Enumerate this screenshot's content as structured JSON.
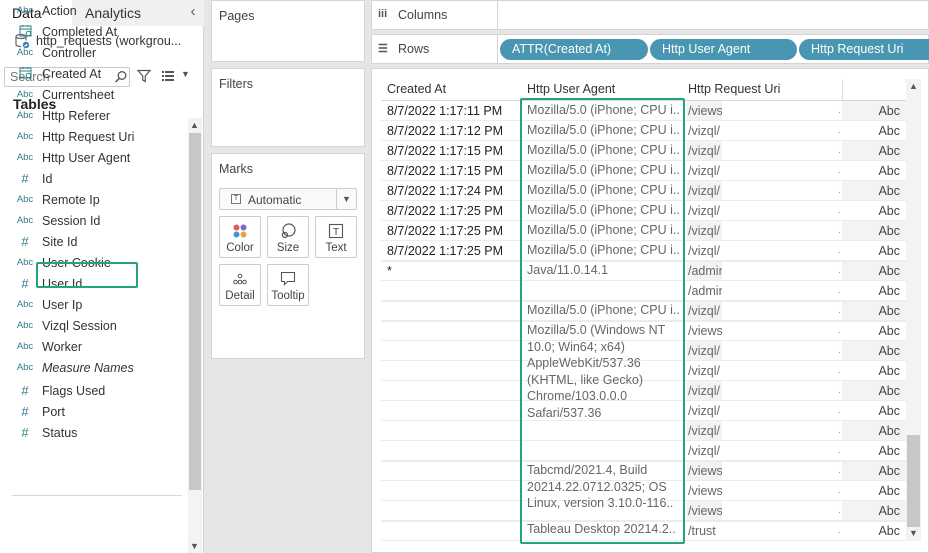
{
  "left_pane": {
    "tab_data": "Data",
    "tab_analytics": "Analytics",
    "datasource": "http_requests (workgrou...",
    "search_placeholder": "Search",
    "tables_title": "Tables",
    "fields": [
      {
        "type": "Abc",
        "name": "Action"
      },
      {
        "type": "date",
        "name": "Completed At"
      },
      {
        "type": "Abc",
        "name": "Controller"
      },
      {
        "type": "date",
        "name": "Created At"
      },
      {
        "type": "Abc",
        "name": "Currentsheet"
      },
      {
        "type": "Abc",
        "name": "Http Referer"
      },
      {
        "type": "Abc",
        "name": "Http Request Uri"
      },
      {
        "type": "Abc",
        "name": "Http User Agent"
      },
      {
        "type": "#",
        "name": "Id"
      },
      {
        "type": "Abc",
        "name": "Remote Ip"
      },
      {
        "type": "Abc",
        "name": "Session Id"
      },
      {
        "type": "#",
        "name": "Site Id"
      },
      {
        "type": "Abc",
        "name": "User Cookie"
      },
      {
        "type": "#",
        "name": "User Id"
      },
      {
        "type": "Abc",
        "name": "User Ip"
      },
      {
        "type": "Abc",
        "name": "Vizql Session"
      },
      {
        "type": "Abc",
        "name": "Worker"
      },
      {
        "type": "Abc",
        "name": "Measure Names"
      }
    ],
    "measures": [
      {
        "type": "#",
        "name": "Flags Used"
      },
      {
        "type": "#",
        "name": "Port"
      },
      {
        "type": "#",
        "name": "Status"
      }
    ],
    "selected_field": "Http User Agent"
  },
  "shelves": {
    "pages": "Pages",
    "filters": "Filters",
    "marks": "Marks",
    "mark_type": "Automatic",
    "mark_buttons": [
      "Color",
      "Size",
      "Text",
      "Detail",
      "Tooltip"
    ],
    "columns": "Columns",
    "rows": "Rows",
    "row_pills": [
      "ATTR(Created At)",
      "Http User Agent",
      "Http Request Uri"
    ]
  },
  "table": {
    "headers": [
      "Created At",
      "Http User Agent",
      "Http Request Uri"
    ],
    "dates": [
      "8/7/2022 1:17:11 PM",
      "8/7/2022 1:17:12 PM",
      "8/7/2022 1:17:15 PM",
      "8/7/2022 1:17:15 PM",
      "8/7/2022 1:17:24 PM",
      "8/7/2022 1:17:25 PM",
      "8/7/2022 1:17:25 PM",
      "8/7/2022 1:17:25 PM",
      "*"
    ],
    "agents": [
      "Mozilla/5.0 (iPhone; CPU i..",
      "Mozilla/5.0 (iPhone; CPU i..",
      "Mozilla/5.0 (iPhone; CPU i..",
      "Mozilla/5.0 (iPhone; CPU i..",
      "Mozilla/5.0 (iPhone; CPU i..",
      "Mozilla/5.0 (iPhone; CPU i..",
      "Mozilla/5.0 (iPhone; CPU i..",
      "Mozilla/5.0 (iPhone; CPU i..",
      "Java/11.0.14.1",
      "Mozilla/5.0 (iPhone; CPU i..",
      "Mozilla/5.0 (Windows NT 10.0; Win64; x64) AppleWebKit/537.36 (KHTML, like Gecko) Chrome/103.0.0.0 Safari/537.36",
      "Tabcmd/2021.4, Build 20214.22.0712.0325; OS Linux, version 3.10.0-116..",
      "Tableau Desktop 20214.2.."
    ],
    "uris": [
      "/views",
      "/vizql/",
      "/vizql/",
      "/vizql/",
      "/vizql/",
      "/vizql/",
      "/vizql/",
      "/vizql/",
      "/admin",
      "/admin",
      "/vizql/",
      "/views",
      "/vizql/",
      "/vizql/",
      "/vizql/",
      "/vizql/",
      "/vizql/",
      "/vizql/",
      "/views",
      "/views",
      "/views",
      "/trust"
    ],
    "abc": "Abc"
  }
}
